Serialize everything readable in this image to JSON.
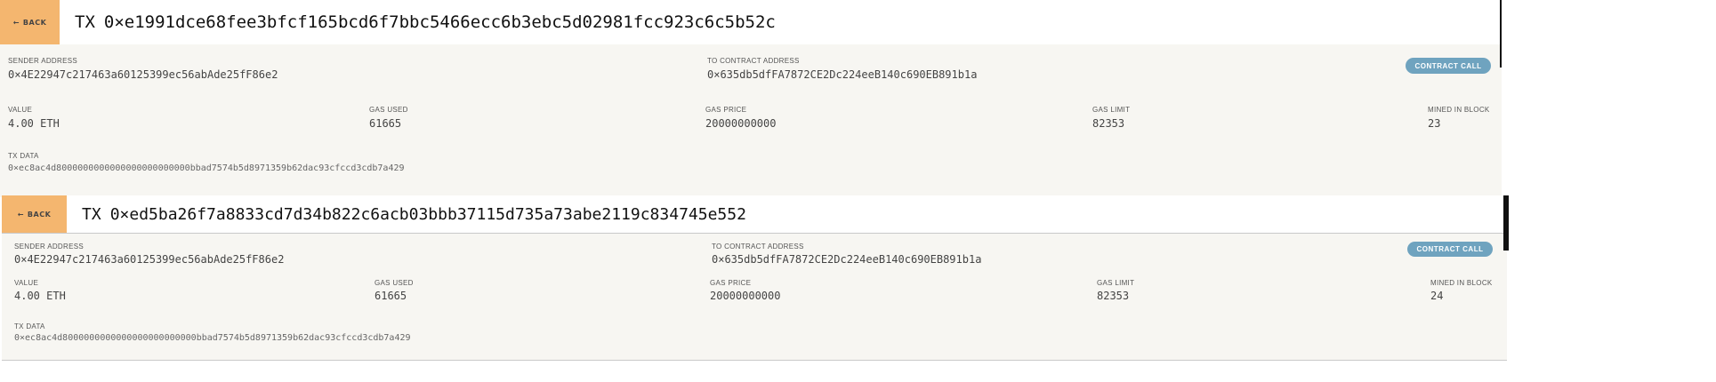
{
  "back_label": "Back",
  "tx_prefix": "TX",
  "labels": {
    "sender": "Sender Address",
    "to_contract": "To Contract Address",
    "value": "Value",
    "gas_used": "Gas Used",
    "gas_price": "Gas Price",
    "gas_limit": "Gas Limit",
    "mined_in_block": "Mined In Block",
    "tx_data": "TX Data"
  },
  "colors": {
    "back_button": "#f4b66f",
    "badge": "#6fa3bf",
    "panel": "#f7f6f2"
  },
  "transactions": [
    {
      "hash": "0×e1991dce68fee3bfcf165bcd6f7bbc5466ecc6b3ebc5d02981fcc923c6c5b52c",
      "sender": "0×4E22947c217463a60125399ec56abAde25fF86e2",
      "to_contract": "0×635db5dfFA7872CE2Dc224eeB140c690EB891b1a",
      "badge": "Contract Call",
      "value": "4.00 ETH",
      "gas_used": "61665",
      "gas_price": "20000000000",
      "gas_limit": "82353",
      "mined_in_block": "23",
      "tx_data": "0×ec8ac4d8000000000000000000000000bbad7574b5d8971359b62dac93cfccd3cdb7a429"
    },
    {
      "hash": "0×ed5ba26f7a8833cd7d34b822c6acb03bbb37115d735a73abe2119c834745e552",
      "sender": "0×4E22947c217463a60125399ec56abAde25fF86e2",
      "to_contract": "0×635db5dfFA7872CE2Dc224eeB140c690EB891b1a",
      "badge": "Contract Call",
      "value": "4.00 ETH",
      "gas_used": "61665",
      "gas_price": "20000000000",
      "gas_limit": "82353",
      "mined_in_block": "24",
      "tx_data": "0×ec8ac4d8000000000000000000000000bbad7574b5d8971359b62dac93cfccd3cdb7a429"
    }
  ]
}
